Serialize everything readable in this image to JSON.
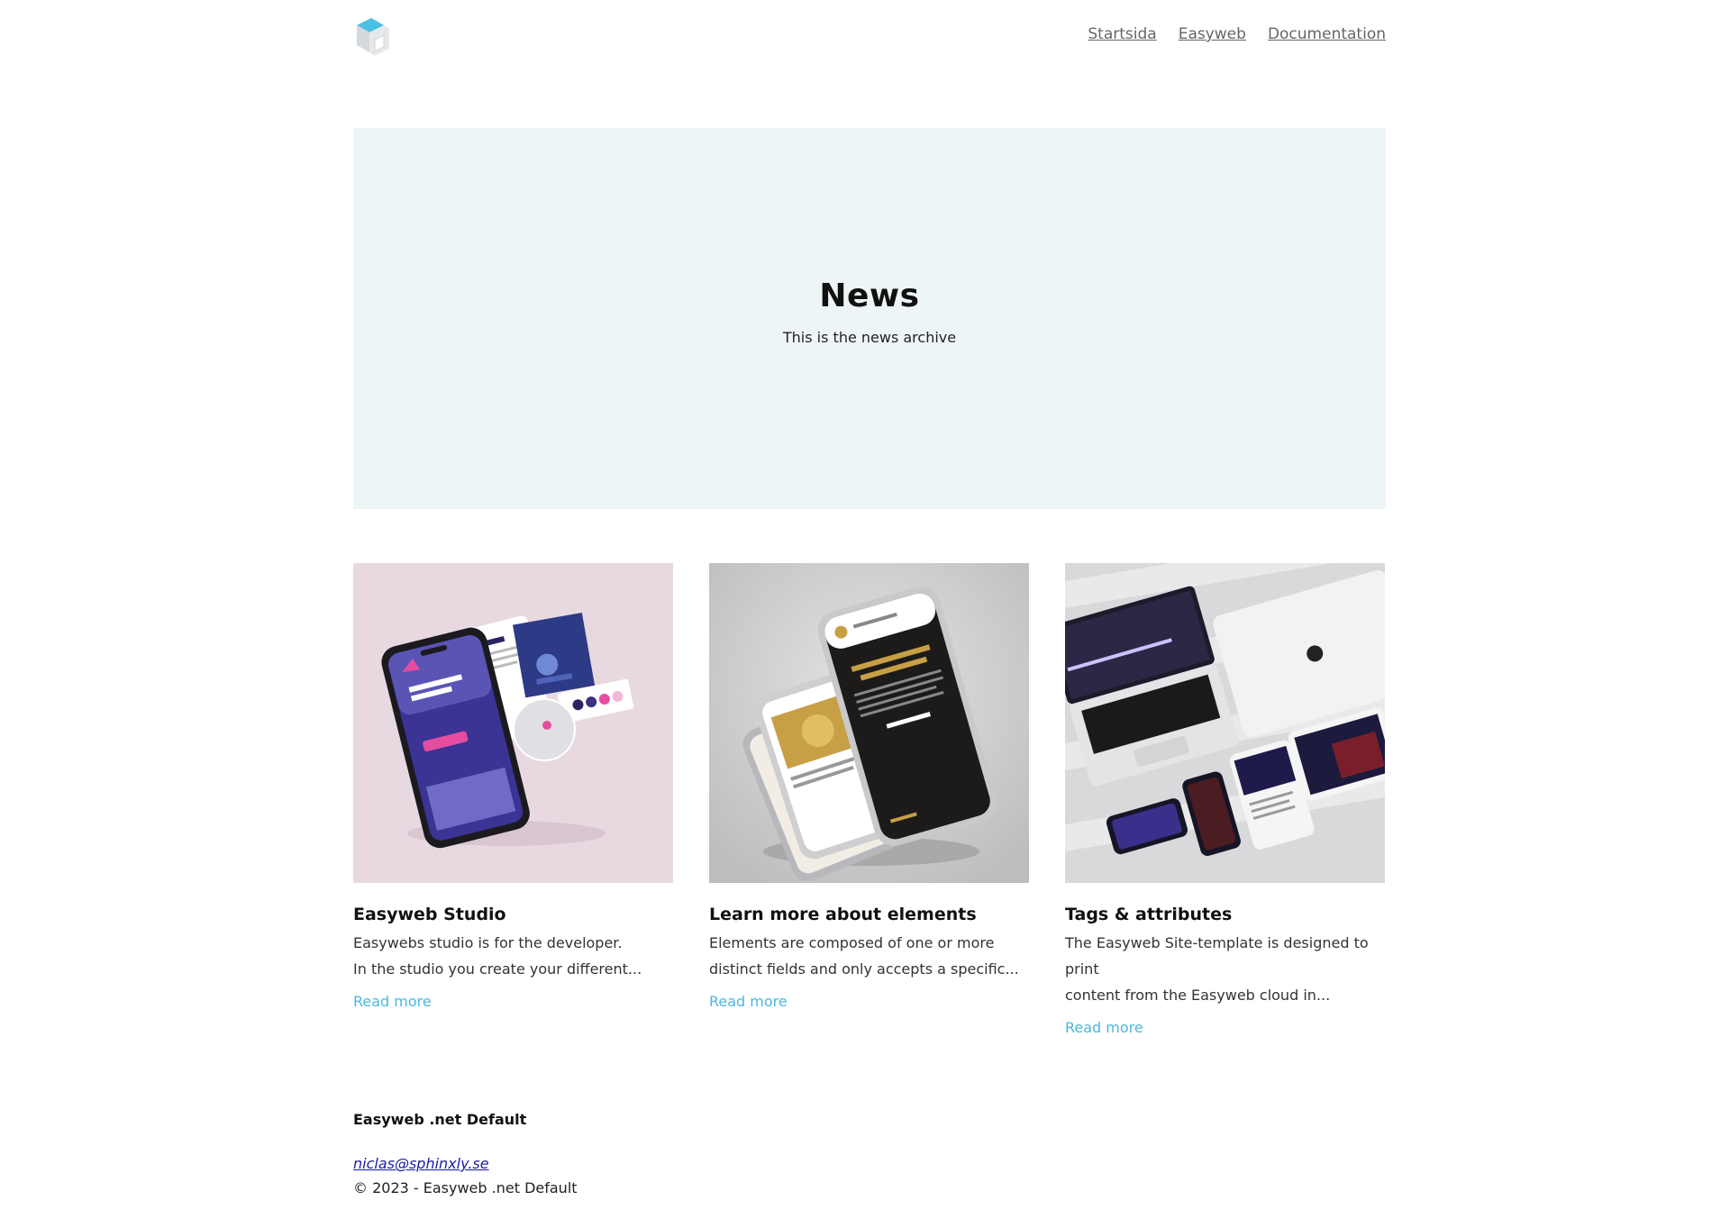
{
  "header": {
    "logo_icon": "cube-logo-icon",
    "nav": [
      {
        "label": "Startsida"
      },
      {
        "label": "Easyweb"
      },
      {
        "label": "Documentation"
      }
    ]
  },
  "hero": {
    "title": "News",
    "subtitle": "This is the news archive",
    "background": "#eef5f7"
  },
  "cards": [
    {
      "title": "Easyweb Studio",
      "excerpt_line1": "Easywebs studio is for the developer.",
      "excerpt_line2": "In the studio you create your different...",
      "read_more": "Read more",
      "image_icon": "phone-mockup-image"
    },
    {
      "title": "Learn more about elements",
      "excerpt_line1": "Elements are composed of one or more",
      "excerpt_line2": "distinct fields and only accepts a specific...",
      "read_more": "Read more",
      "image_icon": "stacked-phones-image"
    },
    {
      "title": "Tags & attributes",
      "excerpt_line1": "The Easyweb Site-template is designed to print",
      "excerpt_line2": "content from the Easyweb cloud in...",
      "read_more": "Read more",
      "image_icon": "laptop-devices-image"
    }
  ],
  "footer": {
    "site_name": "Easyweb .net Default",
    "email": "niclas@sphinxly.se",
    "copyright": "© 2023 - Easyweb .net Default"
  },
  "colors": {
    "accent": "#4bb8dd",
    "hero_bg": "#eef5f7",
    "link": "#1a1aa6"
  }
}
